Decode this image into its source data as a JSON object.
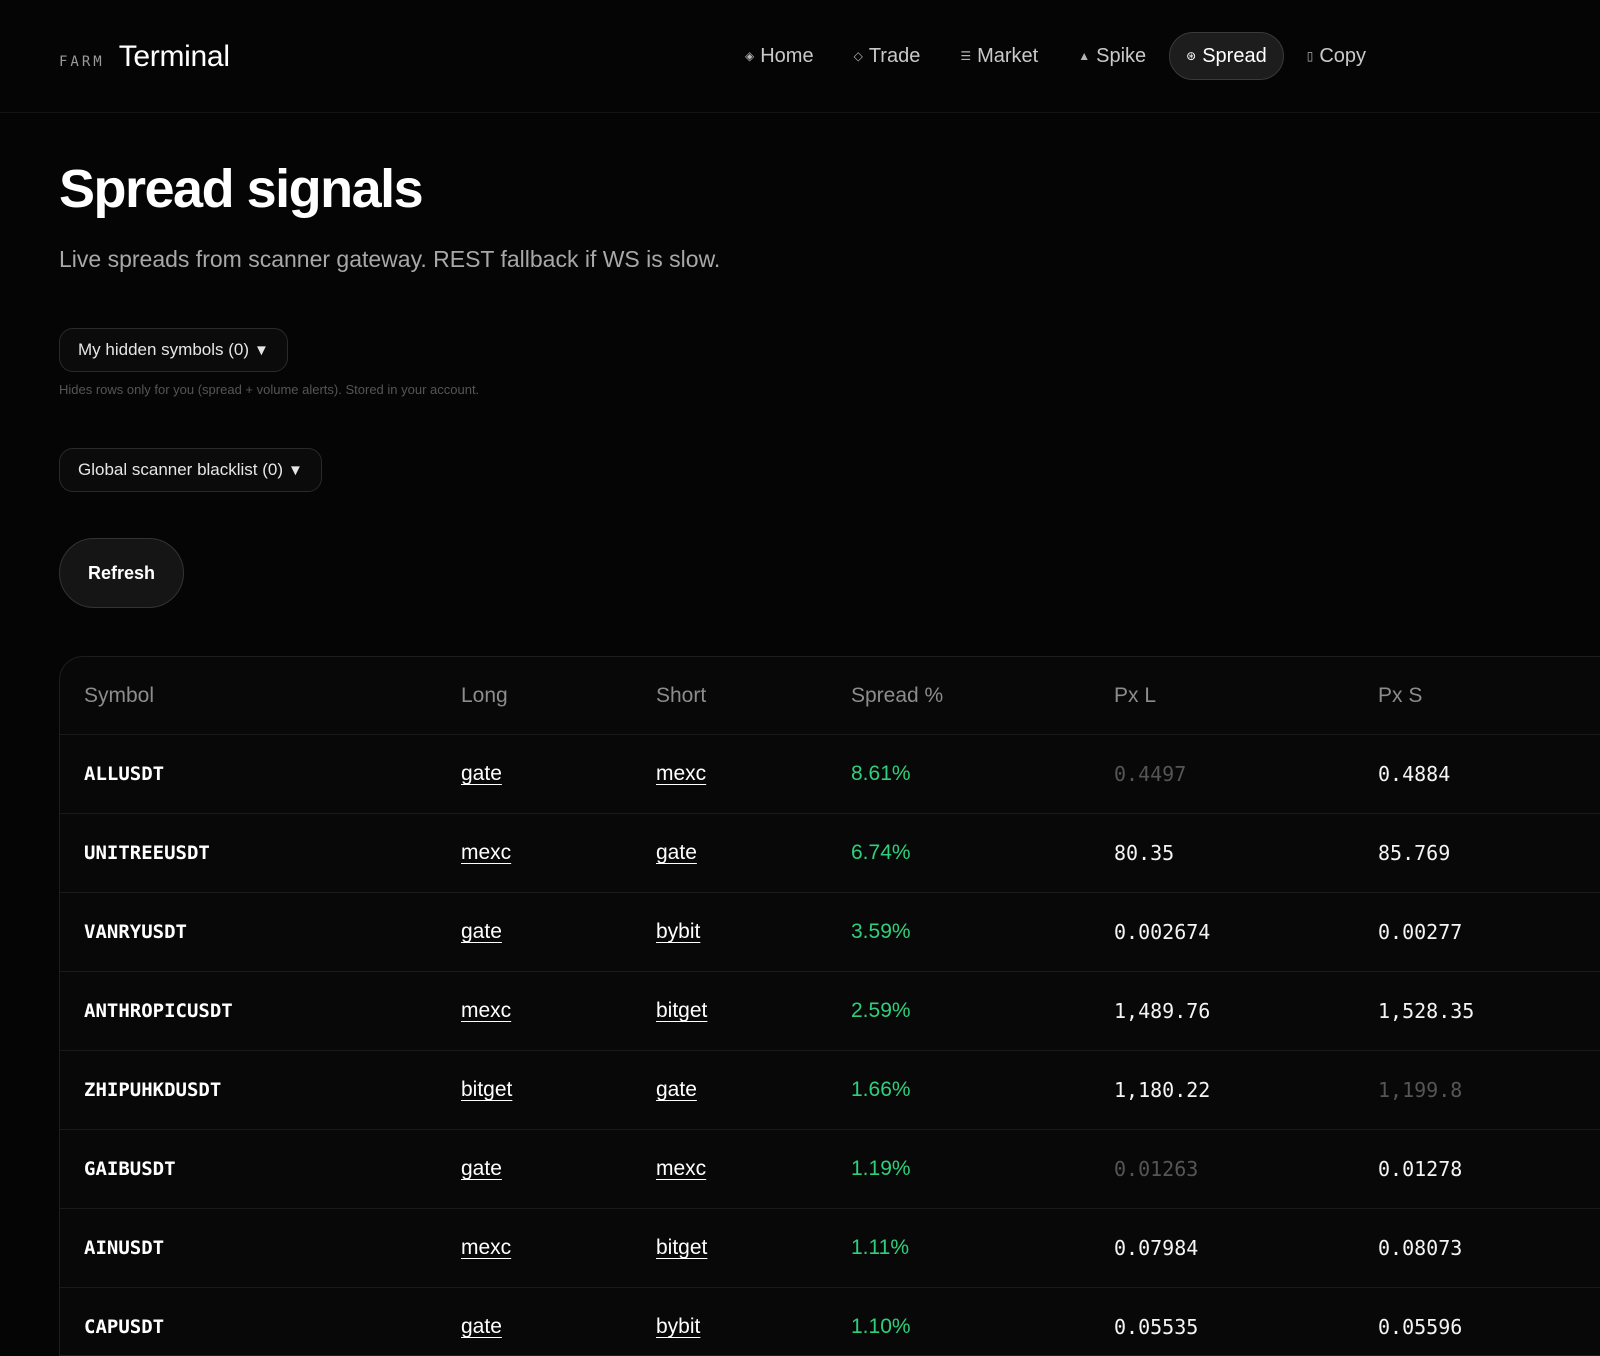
{
  "brand": {
    "small": "FARM",
    "big": "Terminal"
  },
  "nav": [
    {
      "icon": "◈",
      "label": "Home"
    },
    {
      "icon": "◇",
      "label": "Trade"
    },
    {
      "icon": "☰",
      "label": "Market"
    },
    {
      "icon": "▲",
      "label": "Spike"
    },
    {
      "icon": "⊛",
      "label": "Spread"
    },
    {
      "icon": "▯",
      "label": "Copy"
    }
  ],
  "page": {
    "title": "Spread signals",
    "subtitle": "Live spreads from scanner gateway. REST fallback if WS is slow."
  },
  "filters": {
    "hidden_label": "My hidden symbols (0)",
    "hidden_hint": "Hides rows only for you (spread + volume alerts). Stored in your account.",
    "blacklist_label": "Global scanner blacklist (0)",
    "caret": "▼"
  },
  "actions": {
    "refresh_label": "Refresh"
  },
  "table": {
    "columns": [
      "Symbol",
      "Long",
      "Short",
      "Spread %",
      "Px L",
      "Px S"
    ],
    "rows": [
      {
        "symbol": "ALLUSDT",
        "long": "gate",
        "short": "mexc",
        "spread": "8.61%",
        "px_l": "0.4497",
        "px_s": "0.4884"
      },
      {
        "symbol": "UNITREEUSDT",
        "long": "mexc",
        "short": "gate",
        "spread": "6.74%",
        "px_l": "80.35",
        "px_s": "85.769"
      },
      {
        "symbol": "VANRYUSDT",
        "long": "gate",
        "short": "bybit",
        "spread": "3.59%",
        "px_l": "0.002674",
        "px_s": "0.00277"
      },
      {
        "symbol": "ANTHROPICUSDT",
        "long": "mexc",
        "short": "bitget",
        "spread": "2.59%",
        "px_l": "1,489.76",
        "px_s": "1,528.35"
      },
      {
        "symbol": "ZHIPUHKDUSDT",
        "long": "bitget",
        "short": "gate",
        "spread": "1.66%",
        "px_l": "1,180.22",
        "px_s": "1,199.8"
      },
      {
        "symbol": "GAIBUSDT",
        "long": "gate",
        "short": "mexc",
        "spread": "1.19%",
        "px_l": "0.01263",
        "px_s": "0.01278"
      },
      {
        "symbol": "AINUSDT",
        "long": "mexc",
        "short": "bitget",
        "spread": "1.11%",
        "px_l": "0.07984",
        "px_s": "0.08073"
      },
      {
        "symbol": "CAPUSDT",
        "long": "gate",
        "short": "bybit",
        "spread": "1.10%",
        "px_l": "0.05535",
        "px_s": "0.05596"
      }
    ]
  },
  "colors": {
    "background": "#050505",
    "positive": "#2ecf7c",
    "muted_price": "#555555",
    "active_nav_bg": "#1d1d1d"
  }
}
